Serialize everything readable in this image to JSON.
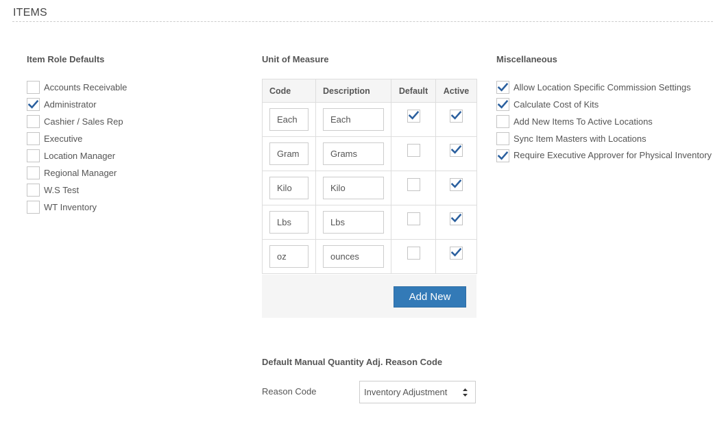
{
  "page": {
    "title": "ITEMS"
  },
  "role_defaults": {
    "heading": "Item Role Defaults",
    "items": [
      {
        "label": "Accounts Receivable",
        "checked": false
      },
      {
        "label": "Administrator",
        "checked": true
      },
      {
        "label": "Cashier / Sales Rep",
        "checked": false
      },
      {
        "label": "Executive",
        "checked": false
      },
      {
        "label": "Location Manager",
        "checked": false
      },
      {
        "label": "Regional Manager",
        "checked": false
      },
      {
        "label": "W.S Test",
        "checked": false
      },
      {
        "label": "WT Inventory",
        "checked": false
      }
    ]
  },
  "uom": {
    "heading": "Unit of Measure",
    "columns": {
      "code": "Code",
      "description": "Description",
      "default": "Default",
      "active": "Active"
    },
    "rows": [
      {
        "code": "Each",
        "description": "Each",
        "default": true,
        "active": true
      },
      {
        "code": "Gram",
        "description": "Grams",
        "default": false,
        "active": true
      },
      {
        "code": "Kilo",
        "description": "Kilo",
        "default": false,
        "active": true
      },
      {
        "code": "Lbs",
        "description": "Lbs",
        "default": false,
        "active": true
      },
      {
        "code": "oz",
        "description": "ounces",
        "default": false,
        "active": true
      }
    ],
    "add_new_label": "Add New"
  },
  "misc": {
    "heading": "Miscellaneous",
    "items": [
      {
        "label": "Allow Location Specific Commission Settings",
        "checked": true
      },
      {
        "label": "Calculate Cost of Kits",
        "checked": true
      },
      {
        "label": "Add New Items To Active Locations",
        "checked": false
      },
      {
        "label": "Sync Item Masters with Locations",
        "checked": false
      },
      {
        "label": "Require Executive Approver for Physical Inventory",
        "checked": true
      }
    ]
  },
  "reason": {
    "heading": "Default Manual Quantity Adj. Reason Code",
    "label": "Reason Code",
    "selected": "Inventory Adjustment"
  },
  "colors": {
    "accent": "#337ab7",
    "check": "#2a5f9e",
    "border": "#c4c4c4"
  },
  "icons": {
    "check": "checkmark-icon",
    "select": "updown-arrows-icon"
  }
}
